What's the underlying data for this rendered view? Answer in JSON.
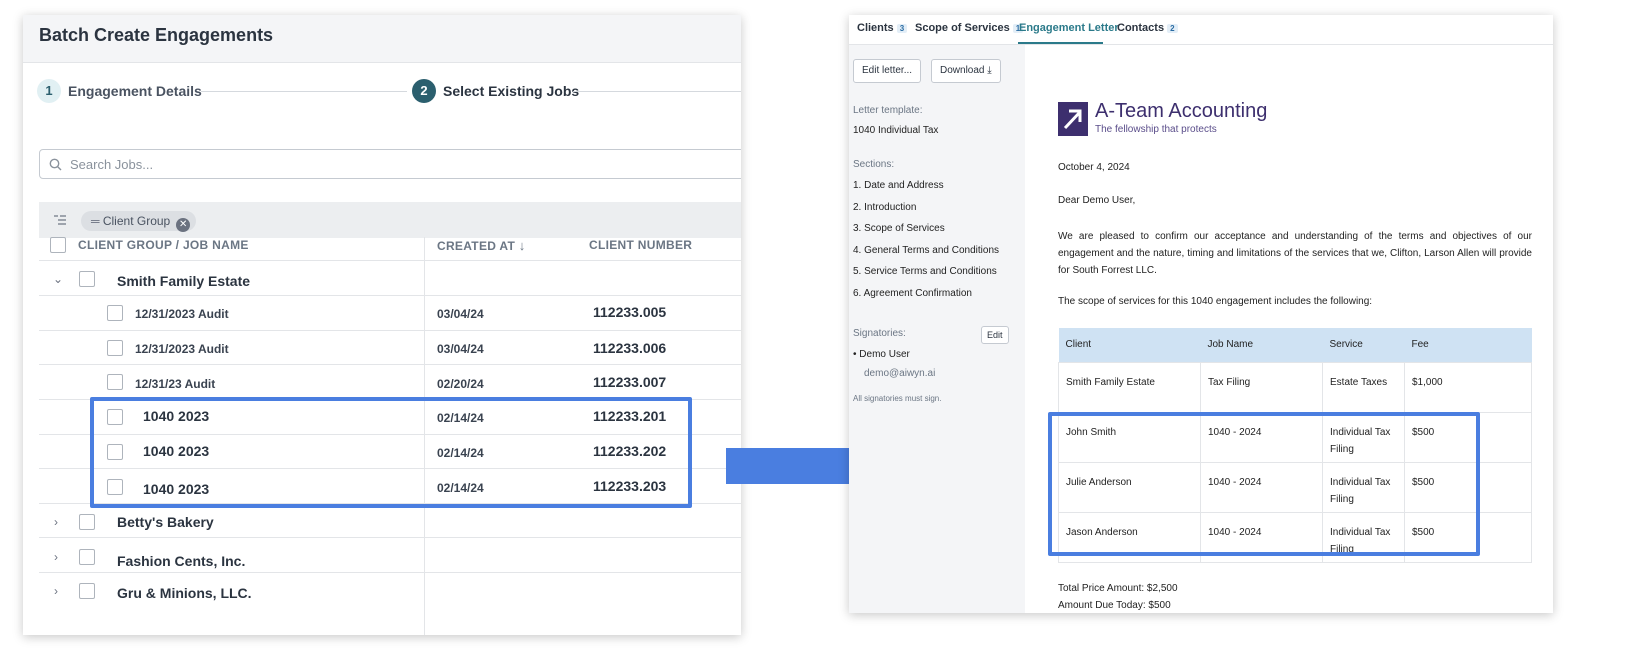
{
  "left": {
    "title": "Batch Create Engagements",
    "steps": [
      {
        "number": "1",
        "label": "Engagement Details"
      },
      {
        "number": "2",
        "label": "Select Existing Jobs"
      }
    ],
    "search_placeholder": "Search Jobs...",
    "filter_chip": "Client Group",
    "columns": [
      "CLIENT GROUP / JOB NAME",
      "CREATED AT",
      "CLIENT NUMBER"
    ],
    "groups": [
      {
        "name": "Smith Family Estate",
        "expanded": true
      },
      {
        "name": "Betty's Bakery",
        "expanded": false
      },
      {
        "name": "Fashion Cents, Inc.",
        "expanded": false
      },
      {
        "name": "Gru & Minions, LLC.",
        "expanded": false
      }
    ],
    "jobs": [
      {
        "name": "12/31/2023 Audit",
        "created": "03/04/24",
        "number": "112233.005"
      },
      {
        "name": "12/31/2023 Audit",
        "created": "03/04/24",
        "number": "112233.006"
      },
      {
        "name": "12/31/23 Audit",
        "created": "02/20/24",
        "number": "112233.007"
      },
      {
        "name": "1040 2023",
        "created": "02/14/24",
        "number": "112233.201"
      },
      {
        "name": "1040 2023",
        "created": "02/14/24",
        "number": "112233.202"
      },
      {
        "name": "1040 2023",
        "created": "02/14/24",
        "number": "112233.203"
      }
    ],
    "colors": {
      "highlight": "#4a7ee0",
      "step_active": "#2b5f6e",
      "step_inactive_bg": "#e1f0f3"
    }
  },
  "right": {
    "tabs": [
      {
        "label": "Clients",
        "badge": "3"
      },
      {
        "label": "Scope of Services",
        "badge": "1"
      },
      {
        "label": "Engagement Letter",
        "badge": ""
      },
      {
        "label": "Contacts",
        "badge": "2"
      }
    ],
    "buttons": {
      "edit_letter": "Edit letter...",
      "download": "Download",
      "edit": "Edit"
    },
    "letter_template_label": "Letter template:",
    "letter_template": "1040 Individual Tax",
    "sections_label": "Sections:",
    "sections": [
      "1. Date and Address",
      "2. Introduction",
      "3. Scope of Services",
      "4. General Terms and Conditions",
      "5. Service Terms and Conditions",
      "6. Agreement Confirmation"
    ],
    "signatories_label": "Signatories:",
    "signatory_name": "Demo User",
    "signatory_email": "demo@aiwyn.ai",
    "signatory_note": "All signatories must sign.",
    "letter": {
      "company": "A-Team Accounting",
      "tagline": "The fellowship that protects",
      "date": "October 4, 2024",
      "greeting": "Dear Demo User,",
      "intro": "We are pleased to confirm our acceptance and understanding of the terms and objectives of our engagement and the nature, timing and limitations of the services that we, Clifton, Larson Allen will provide for South Forrest LLC.",
      "scope_intro": "The scope of services for this 1040 engagement includes the following:",
      "table_headers": [
        "Client",
        "Job Name",
        "Service",
        "Fee"
      ],
      "table_rows": [
        [
          "Smith Family Estate",
          "Tax Filing",
          "Estate Taxes",
          "$1,000"
        ],
        [
          "John Smith",
          "1040 - 2024",
          "Individual Tax Filing",
          "$500"
        ],
        [
          "Julie Anderson",
          "1040 - 2024",
          "Individual Tax Filing",
          "$500"
        ],
        [
          "Jason Anderson",
          "1040 - 2024",
          "Individual Tax Filing",
          "$500"
        ]
      ],
      "total": "Total Price Amount: $2,500",
      "due": "Amount Due Today: $500"
    }
  },
  "arrow_color": "#4a7ee0"
}
